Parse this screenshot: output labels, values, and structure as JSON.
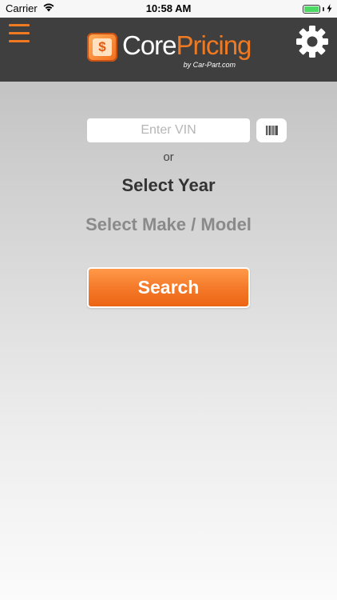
{
  "status_bar": {
    "carrier": "Carrier",
    "time": "10:58 AM",
    "icons": [
      "wifi-icon",
      "battery-icon",
      "charging-bolt-icon"
    ]
  },
  "header": {
    "logo_icon_letter": "$",
    "logo_core": "Core",
    "logo_pricing": "Pricing",
    "logo_sub": "by Car-Part.com",
    "menu_icon": "hamburger-menu-icon",
    "settings_icon": "gear-icon"
  },
  "form": {
    "vin_placeholder": "Enter VIN",
    "vin_value": "",
    "barcode_icon": "barcode-icon",
    "or_label": "or",
    "select_year": "Select Year",
    "select_make_model": "Select Make / Model",
    "search_label": "Search"
  },
  "colors": {
    "accent": "#f07a22",
    "header_bg": "#3f3f3f",
    "battery_green": "#4cd964"
  }
}
